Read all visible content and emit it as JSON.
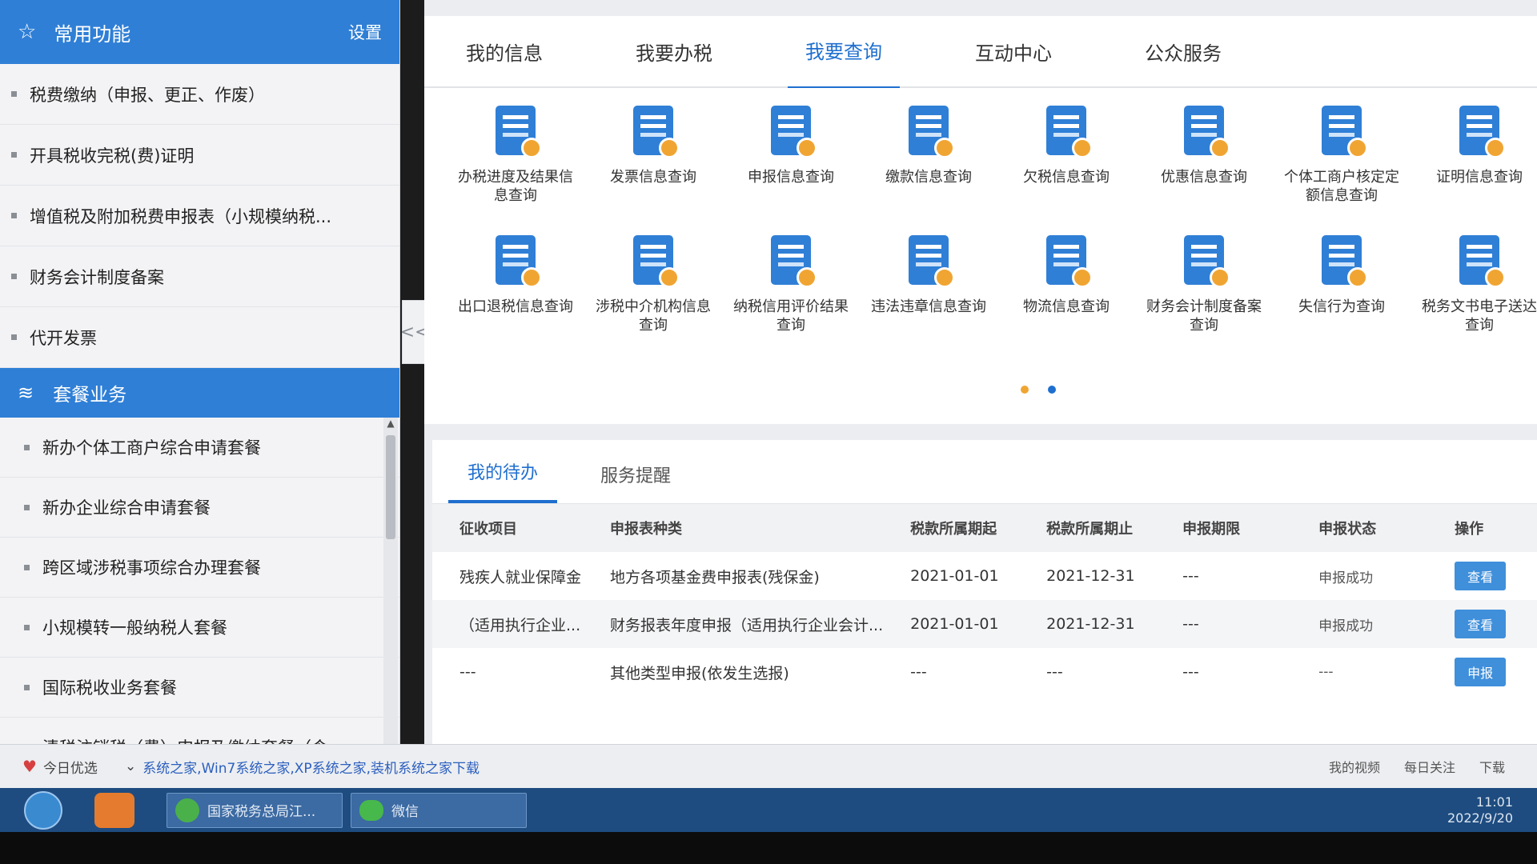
{
  "sidebar": {
    "common_title": "常用功能",
    "settings_label": "设置",
    "common_items": [
      "税费缴纳（申报、更正、作废）",
      "开具税收完税(费)证明",
      "增值税及附加税费申报表（小规模纳税...",
      "财务会计制度备案",
      "代开发票"
    ],
    "package_title": "套餐业务",
    "package_items": [
      "新办个体工商户综合申请套餐",
      "新办企业综合申请套餐",
      "跨区域涉税事项综合办理套餐",
      "小规模转一般纳税人套餐",
      "国际税收业务套餐",
      "清税注销税（费）申报及缴纳套餐（含..."
    ],
    "collapse_label": "<<"
  },
  "topnav": {
    "tabs": [
      "我的信息",
      "我要办税",
      "我要查询",
      "互动中心",
      "公众服务"
    ],
    "active": "我要查询"
  },
  "icons": [
    "办税进度及结果信息查询",
    "发票信息查询",
    "申报信息查询",
    "缴款信息查询",
    "欠税信息查询",
    "优惠信息查询",
    "个体工商户核定定额信息查询",
    "证明信息查询",
    "出口退税信息查询",
    "涉税中介机构信息查询",
    "纳税信用评价结果查询",
    "违法违章信息查询",
    "物流信息查询",
    "财务会计制度备案查询",
    "失信行为查询",
    "税务文书电子送达查询"
  ],
  "todo": {
    "tabs": [
      "我的待办",
      "服务提醒"
    ],
    "active": "我的待办",
    "columns": [
      "征收项目",
      "申报表种类",
      "税款所属期起",
      "税款所属期止",
      "申报期限",
      "申报状态",
      "操作"
    ],
    "rows": [
      {
        "item": "残疾人就业保障金",
        "type": "地方各项基金费申报表(残保金)",
        "start": "2021-01-01",
        "end": "2021-12-31",
        "deadline": "---",
        "status": "申报成功",
        "action": "查看"
      },
      {
        "item": "（适用执行企业...",
        "type": "财务报表年度申报（适用执行企业会计...",
        "start": "2021-01-01",
        "end": "2021-12-31",
        "deadline": "---",
        "status": "申报成功",
        "action": "查看"
      },
      {
        "item": "---",
        "type": "其他类型申报(依发生选报)",
        "start": "---",
        "end": "---",
        "deadline": "---",
        "status": "---",
        "action": "申报"
      }
    ]
  },
  "statusbar": {
    "today": "今日优选",
    "link": "系统之家,Win7系统之家,XP系统之家,装机系统之家下载",
    "my_video": "我的视频",
    "daily": "每日关注",
    "download": "下载"
  },
  "taskbar": {
    "task1": "国家税务总局江...",
    "task2": "微信",
    "time": "11:01",
    "date": "2022/9/20"
  },
  "colors": {
    "accent": "#2f7fd6",
    "orange": "#f0a533"
  }
}
